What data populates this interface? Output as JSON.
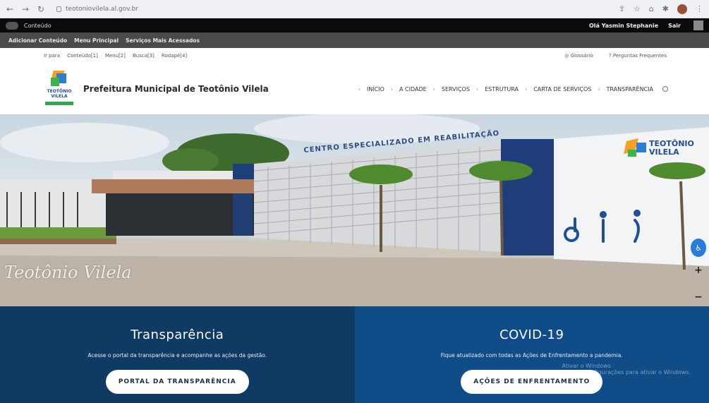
{
  "browser": {
    "url": "teotoniovilela.al.gov.br"
  },
  "admin_bar": {
    "left_label": "Conteúdo",
    "greeting": "Olá Yasmin Stephanie",
    "logout": "Sair"
  },
  "toolbar": {
    "items": [
      "Adicionar Conteúdo",
      "Menu Principal",
      "Serviços Mais Acessados"
    ]
  },
  "accessibility": {
    "items": [
      "Ir para",
      "Conteúdo[1]",
      "Menu[2]",
      "Busca[3]",
      "Rodapé[4]"
    ],
    "glossary": "Glossário",
    "faq": "Perguntas Frequentes"
  },
  "header": {
    "logo_text": "TEOTÔNIO VILELA",
    "title": "Prefeitura Municipal de Teotônio Vilela",
    "nav": [
      "INÍCIO",
      "A CIDADE",
      "SERVIÇOS",
      "ESTRUTURA",
      "CARTA DE SERVIÇOS",
      "TRANSPARÊNCIA"
    ]
  },
  "hero": {
    "sign_building": "CENTRO ESPECIALIZADO EM REABILITAÇÃO",
    "sign_logo": "TEOTÔNIO VILELA",
    "script_caption": "Teotônio Vilela",
    "side_tools": [
      "+",
      "−",
      "=",
      "◐"
    ]
  },
  "panels": {
    "left": {
      "title": "Transparência",
      "text": "Acesse o portal da transparência e acompanhe as ações da gestão.",
      "button": "PORTAL DA TRANSPARÊNCIA"
    },
    "right": {
      "title": "COVID-19",
      "text": "Fique atualizado com todas as Ações de Enfrentamento a pandemia.",
      "button": "AÇÕES DE ENFRENTAMENTO",
      "watermark_line1": "Ativar o Windows",
      "watermark_line2": "Acesse Configurações para ativar o Windows."
    }
  },
  "colors": {
    "panel_left": "#0e3a63",
    "panel_right": "#0f4c88",
    "accent_blue": "#2b7bd8"
  }
}
